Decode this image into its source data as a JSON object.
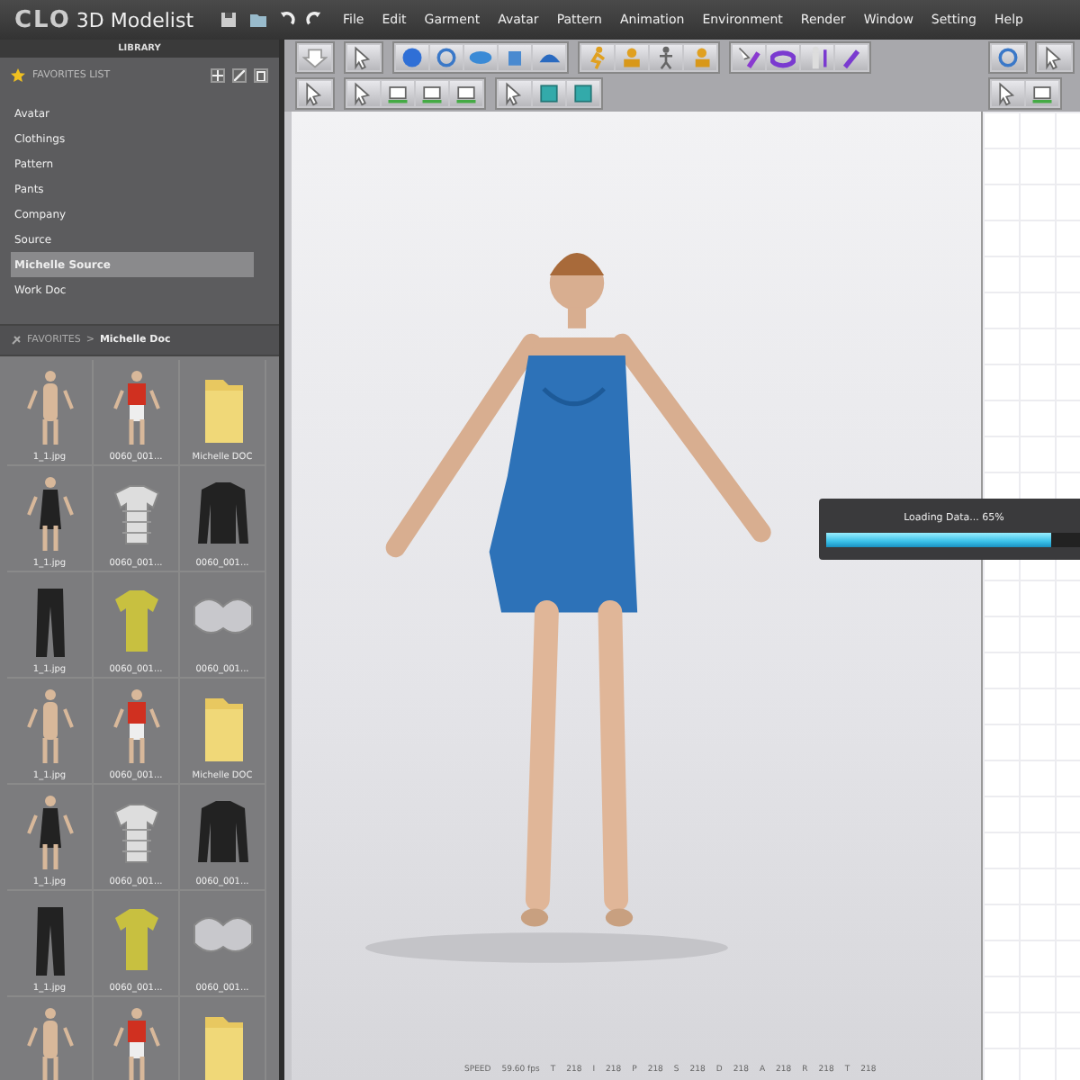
{
  "app": {
    "logo": "CLO",
    "title": "3D Modelist"
  },
  "menu": [
    "File",
    "Edit",
    "Garment",
    "Avatar",
    "Pattern",
    "Animation",
    "Environment",
    "Render",
    "Window",
    "Setting",
    "Help"
  ],
  "library": {
    "title": "LIBRARY",
    "favorites_title": "FAVORITES LIST",
    "items": [
      {
        "label": "Avatar",
        "selected": false
      },
      {
        "label": "Clothings",
        "selected": false
      },
      {
        "label": "Pattern",
        "selected": false
      },
      {
        "label": "Pants",
        "selected": false
      },
      {
        "label": "Company",
        "selected": false
      },
      {
        "label": "Source",
        "selected": false
      },
      {
        "label": "Michelle Source",
        "selected": true
      },
      {
        "label": "Work Doc",
        "selected": false
      }
    ],
    "breadcrumb": {
      "root": "FAVORITES",
      "separator": ">",
      "current": "Michelle Doc"
    },
    "thumbnails": [
      {
        "kind": "avatar",
        "label": "1_1.jpg"
      },
      {
        "kind": "player",
        "label": "0060_001..."
      },
      {
        "kind": "folder",
        "label": "Michelle DOC"
      },
      {
        "kind": "dress",
        "label": "1_1.jpg"
      },
      {
        "kind": "polo",
        "label": "0060_001..."
      },
      {
        "kind": "jacket",
        "label": "0060_001..."
      },
      {
        "kind": "pants",
        "label": "1_1.jpg"
      },
      {
        "kind": "tshirt",
        "label": "0060_001..."
      },
      {
        "kind": "pads",
        "label": "0060_001..."
      },
      {
        "kind": "avatar",
        "label": "1_1.jpg"
      },
      {
        "kind": "player",
        "label": "0060_001..."
      },
      {
        "kind": "folder",
        "label": "Michelle DOC"
      },
      {
        "kind": "dress",
        "label": "1_1.jpg"
      },
      {
        "kind": "polo",
        "label": "0060_001..."
      },
      {
        "kind": "jacket",
        "label": "0060_001..."
      },
      {
        "kind": "pants",
        "label": "1_1.jpg"
      },
      {
        "kind": "tshirt",
        "label": "0060_001..."
      },
      {
        "kind": "pads",
        "label": "0060_001..."
      },
      {
        "kind": "avatar"
      },
      {
        "kind": "player"
      },
      {
        "kind": "folder"
      }
    ]
  },
  "loading": {
    "text": "Loading Data... 65%",
    "level": 0.88
  },
  "status_bar": [
    {
      "label": "SPEED",
      "value": "59.60 fps"
    },
    {
      "label": "T",
      "value": "218"
    },
    {
      "label": "I",
      "value": "218"
    },
    {
      "label": "P",
      "value": "218"
    },
    {
      "label": "S",
      "value": "218"
    },
    {
      "label": "D",
      "value": "218"
    },
    {
      "label": "A",
      "value": "218"
    },
    {
      "label": "R",
      "value": "218"
    },
    {
      "label": "T",
      "value": "218"
    }
  ]
}
